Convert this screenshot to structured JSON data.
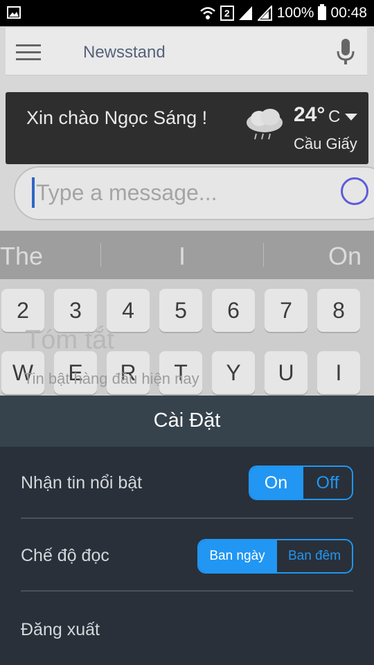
{
  "statusbar": {
    "battery_pct": "100%",
    "time": "00:48",
    "sim": "2"
  },
  "app": {
    "title": "Newsstand"
  },
  "greeting": {
    "text": "Xin chào Ngọc Sáng !",
    "temp": "24°",
    "unit": "C",
    "city": "Cầu Giấy"
  },
  "composer": {
    "placeholder": "Type a message..."
  },
  "suggestions": [
    "The",
    "I",
    "On"
  ],
  "keyboard": {
    "row1": [
      "2",
      "3",
      "4",
      "5",
      "6",
      "7",
      "8"
    ],
    "row2": [
      "W",
      "E",
      "R",
      "T",
      "Y",
      "U",
      "I"
    ]
  },
  "overlay": {
    "title": "Tóm tắt",
    "subtitle": "Tin bật hàng đầu hiện nay"
  },
  "settings": {
    "title": "Cài Đặt",
    "featured": {
      "label": "Nhận tin nổi bật",
      "on": "On",
      "off": "Off",
      "selected": "On"
    },
    "reading": {
      "label": "Chế độ đọc",
      "day": "Ban ngày",
      "night": "Ban đêm",
      "selected": "Ban ngày"
    },
    "logout": {
      "label": "Đăng xuất"
    }
  },
  "colors": {
    "accent": "#2196f3",
    "sheet_bg": "#293039",
    "sheet_header": "#36424c"
  }
}
